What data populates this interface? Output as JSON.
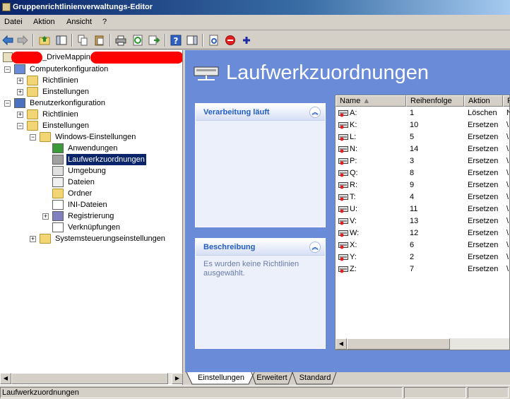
{
  "window": {
    "title": "Gruppenrichtlinienverwaltungs-Editor"
  },
  "menu": [
    "Datei",
    "Aktion",
    "Ansicht",
    "?"
  ],
  "toolbar": {
    "icons": [
      "back-arrow-icon",
      "forward-arrow-icon",
      "up-folder-icon",
      "show-hide-tree-icon",
      "copy-icon",
      "paste-icon",
      "print-icon",
      "refresh-icon",
      "export-icon",
      "help-icon",
      "action-pane-icon",
      "new-item-icon",
      "stop-icon",
      "add-icon"
    ]
  },
  "tree": {
    "root": "_DriveMapping",
    "nodes": [
      {
        "label": "Computerkonfiguration",
        "expander": "−",
        "icon": "computer-icon"
      },
      {
        "label": "Richtlinien",
        "expander": "+",
        "icon": "folder-icon"
      },
      {
        "label": "Einstellungen",
        "expander": "+",
        "icon": "folder-icon"
      },
      {
        "label": "Benutzerkonfiguration",
        "expander": "−",
        "icon": "user-icon"
      },
      {
        "label": "Richtlinien",
        "expander": "+",
        "icon": "folder-icon"
      },
      {
        "label": "Einstellungen",
        "expander": "−",
        "icon": "folder-icon"
      },
      {
        "label": "Windows-Einstellungen",
        "expander": "−",
        "icon": "folder-icon"
      },
      {
        "label": "Anwendungen",
        "expander": "",
        "icon": "application-icon"
      },
      {
        "label": "Laufwerkzuordnungen",
        "expander": "",
        "icon": "drive-mapping-icon"
      },
      {
        "label": "Umgebung",
        "expander": "",
        "icon": "environment-icon"
      },
      {
        "label": "Dateien",
        "expander": "",
        "icon": "files-icon"
      },
      {
        "label": "Ordner",
        "expander": "",
        "icon": "folder-icon"
      },
      {
        "label": "INI-Dateien",
        "expander": "",
        "icon": "ini-file-icon"
      },
      {
        "label": "Registrierung",
        "expander": "+",
        "icon": "registry-icon"
      },
      {
        "label": "Verknüpfungen",
        "expander": "",
        "icon": "shortcut-icon"
      },
      {
        "label": "Systemsteuerungseinstellungen",
        "expander": "+",
        "icon": "control-panel-icon"
      }
    ]
  },
  "content": {
    "title": "Laufwerkzuordnungen",
    "processing_panel": {
      "title": "Verarbeitung läuft"
    },
    "description_panel": {
      "title": "Beschreibung",
      "text": "Es wurden keine Richtlinien ausgewählt."
    },
    "columns": [
      "Name",
      "Reihenfolge",
      "Aktion",
      "P"
    ],
    "rows": [
      {
        "name": "A:",
        "order": "1",
        "action": "Löschen",
        "p": "N"
      },
      {
        "name": "K:",
        "order": "10",
        "action": "Ersetzen",
        "p": "\\"
      },
      {
        "name": "L:",
        "order": "5",
        "action": "Ersetzen",
        "p": "\\"
      },
      {
        "name": "N:",
        "order": "14",
        "action": "Ersetzen",
        "p": "\\"
      },
      {
        "name": "P:",
        "order": "3",
        "action": "Ersetzen",
        "p": "\\"
      },
      {
        "name": "Q:",
        "order": "8",
        "action": "Ersetzen",
        "p": "\\"
      },
      {
        "name": "R:",
        "order": "9",
        "action": "Ersetzen",
        "p": "\\"
      },
      {
        "name": "T:",
        "order": "4",
        "action": "Ersetzen",
        "p": "\\"
      },
      {
        "name": "U:",
        "order": "11",
        "action": "Ersetzen",
        "p": "\\"
      },
      {
        "name": "V:",
        "order": "13",
        "action": "Ersetzen",
        "p": "\\"
      },
      {
        "name": "W:",
        "order": "12",
        "action": "Ersetzen",
        "p": "\\"
      },
      {
        "name": "X:",
        "order": "6",
        "action": "Ersetzen",
        "p": "\\"
      },
      {
        "name": "Y:",
        "order": "2",
        "action": "Ersetzen",
        "p": "\\"
      },
      {
        "name": "Z:",
        "order": "7",
        "action": "Ersetzen",
        "p": "\\"
      }
    ]
  },
  "tabs": [
    "Einstellungen",
    "Erweitert",
    "Standard"
  ],
  "status": {
    "text": "Laufwerkzuordnungen"
  },
  "colors": {
    "title_bar": "#0a246a",
    "content_bg": "#6a8cd8",
    "panel_title": "#215dc6",
    "selection": "#0a246a"
  }
}
